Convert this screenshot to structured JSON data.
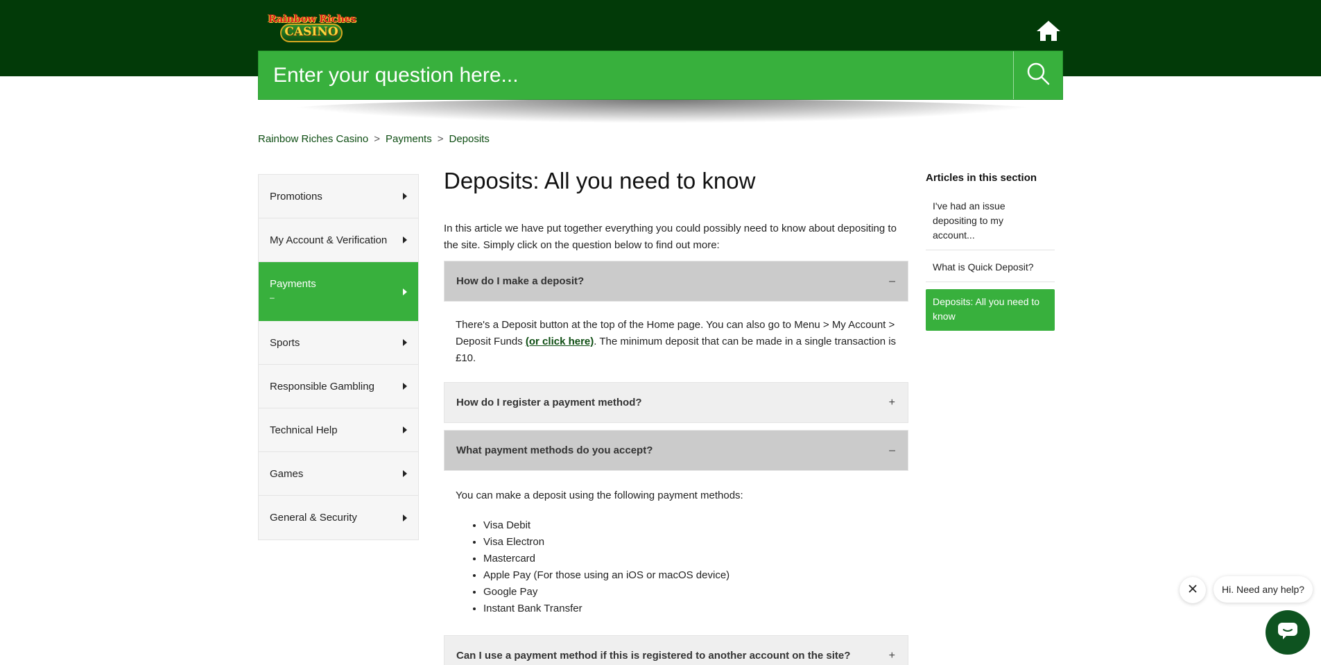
{
  "header": {
    "logo_top": "Rainbow Riches",
    "logo_bottom": "CASINO",
    "home_icon": "home-icon",
    "search_placeholder": "Enter your question here...",
    "search_icon": "search-icon"
  },
  "breadcrumb": {
    "items": [
      "Rainbow Riches Casino",
      "Payments",
      "Deposits"
    ],
    "separator": ">"
  },
  "sidebar": {
    "items": [
      {
        "label": "Promotions"
      },
      {
        "label": "My Account & Verification"
      },
      {
        "label": "Payments",
        "sub": "–"
      },
      {
        "label": "Sports"
      },
      {
        "label": "Responsible Gambling"
      },
      {
        "label": "Technical Help"
      },
      {
        "label": "Games"
      },
      {
        "label": "General & Security"
      }
    ]
  },
  "article": {
    "title": "Deposits: All you need to know",
    "intro": "In this article we have put together everything you could possibly need to know about depositing to the site. Simply click on the question below to find out more:",
    "accordion": [
      {
        "question": "How do I make a deposit?",
        "toggle": "–",
        "answer_part1": "There's a Deposit button at the top of the Home page. You can also go to Menu > My Account > Deposit Funds ",
        "answer_link": "(or click here)",
        "answer_part2": ". The minimum deposit that can be made in a single transaction is £10."
      },
      {
        "question": "How do I register a payment method?",
        "toggle": "+"
      },
      {
        "question": "What payment methods do you accept?",
        "toggle": "–",
        "answer": "You can make a deposit using the following payment methods:",
        "methods": [
          "Visa Debit",
          "Visa Electron",
          "Mastercard",
          "Apple Pay (For those using an iOS or macOS device)",
          "Google Pay",
          "Instant Bank Transfer"
        ]
      },
      {
        "question": "Can I use a payment method if this is registered to another account on the site?",
        "toggle": "+"
      }
    ]
  },
  "articles_section": {
    "heading": "Articles in this section",
    "items": [
      {
        "label": "I've had an issue depositing to my account..."
      },
      {
        "label": "What is Quick Deposit?"
      },
      {
        "label": "Deposits: All you need to know"
      }
    ]
  },
  "chat": {
    "bubble_text": "Hi. Need any help?",
    "close_icon": "close-icon",
    "chat_icon": "chat-icon"
  },
  "colors": {
    "header_bg": "#023a08",
    "accent_green": "#38b03d",
    "link_green": "#0d4d12",
    "chat_button": "#0e5320"
  }
}
